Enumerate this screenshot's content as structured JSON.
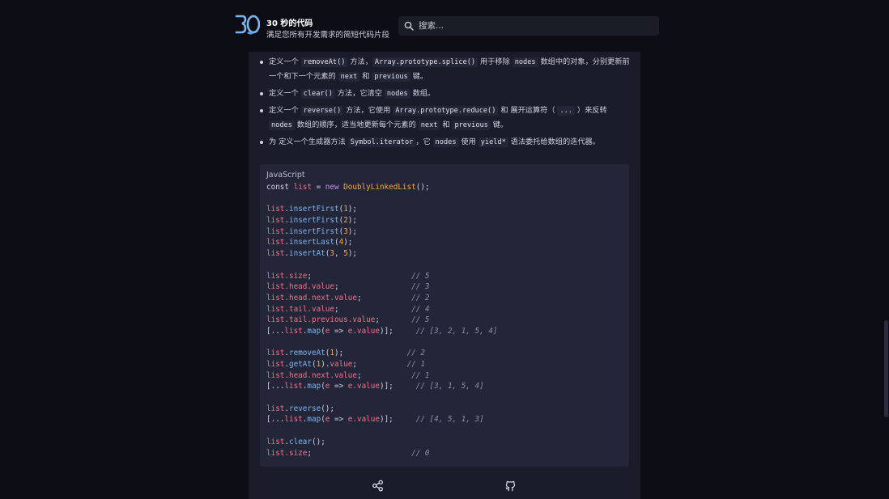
{
  "header": {
    "brand_title": "30 秒的代码",
    "brand_subtitle": "满足您所有开发需求的简短代码片段",
    "search_placeholder": "搜索..."
  },
  "bullets": [
    [
      {
        "t": "text",
        "v": "定义一个 "
      },
      {
        "t": "code",
        "v": "removeAt()"
      },
      {
        "t": "text",
        "v": " 方法，"
      },
      {
        "t": "code",
        "v": "Array.prototype.splice()"
      },
      {
        "t": "text",
        "v": " 用于移除 "
      },
      {
        "t": "code",
        "v": "nodes"
      },
      {
        "t": "text",
        "v": " 数组中的对象，分别更新前一个和下一个元素的 "
      },
      {
        "t": "code",
        "v": "next"
      },
      {
        "t": "text",
        "v": " 和 "
      },
      {
        "t": "code",
        "v": "previous"
      },
      {
        "t": "text",
        "v": " 键。"
      }
    ],
    [
      {
        "t": "text",
        "v": "定义一个 "
      },
      {
        "t": "code",
        "v": "clear()"
      },
      {
        "t": "text",
        "v": " 方法，它清空 "
      },
      {
        "t": "code",
        "v": "nodes"
      },
      {
        "t": "text",
        "v": " 数组。"
      }
    ],
    [
      {
        "t": "text",
        "v": "定义一个 "
      },
      {
        "t": "code",
        "v": "reverse()"
      },
      {
        "t": "text",
        "v": " 方法，它使用 "
      },
      {
        "t": "code",
        "v": "Array.prototype.reduce()"
      },
      {
        "t": "text",
        "v": " 和 展开运算符（ "
      },
      {
        "t": "code",
        "v": "..."
      },
      {
        "t": "text",
        "v": " ）来反转 "
      },
      {
        "t": "code",
        "v": "nodes"
      },
      {
        "t": "text",
        "v": " 数组的顺序，适当地更新每个元素的 "
      },
      {
        "t": "code",
        "v": "next"
      },
      {
        "t": "text",
        "v": " 和 "
      },
      {
        "t": "code",
        "v": "previous"
      },
      {
        "t": "text",
        "v": " 键。"
      }
    ],
    [
      {
        "t": "text",
        "v": "为 定义一个生成器方法 "
      },
      {
        "t": "code",
        "v": "Symbol.iterator"
      },
      {
        "t": "text",
        "v": "，它 "
      },
      {
        "t": "code",
        "v": "nodes"
      },
      {
        "t": "text",
        "v": " 使用 "
      },
      {
        "t": "code",
        "v": "yield*"
      },
      {
        "t": "text",
        "v": " 语法委托给数组的迭代器。"
      }
    ]
  ],
  "code_block": {
    "language": "JavaScript",
    "lines": [
      [
        [
          "kw",
          "const "
        ],
        [
          "var",
          "list"
        ],
        [
          "p",
          " = "
        ],
        [
          "new",
          "new "
        ],
        [
          "cls",
          "DoublyLinkedList"
        ],
        [
          "p",
          "();"
        ]
      ],
      [],
      [
        [
          "var",
          "list"
        ],
        [
          "p",
          "."
        ],
        [
          "fn",
          "insertFirst"
        ],
        [
          "p",
          "("
        ],
        [
          "num",
          "1"
        ],
        [
          "p",
          ");"
        ]
      ],
      [
        [
          "var",
          "list"
        ],
        [
          "p",
          "."
        ],
        [
          "fn",
          "insertFirst"
        ],
        [
          "p",
          "("
        ],
        [
          "num",
          "2"
        ],
        [
          "p",
          ");"
        ]
      ],
      [
        [
          "var",
          "list"
        ],
        [
          "p",
          "."
        ],
        [
          "fn",
          "insertFirst"
        ],
        [
          "p",
          "("
        ],
        [
          "num",
          "3"
        ],
        [
          "p",
          ");"
        ]
      ],
      [
        [
          "var",
          "list"
        ],
        [
          "p",
          "."
        ],
        [
          "fn",
          "insertLast"
        ],
        [
          "p",
          "("
        ],
        [
          "num",
          "4"
        ],
        [
          "p",
          ");"
        ]
      ],
      [
        [
          "var",
          "list"
        ],
        [
          "p",
          "."
        ],
        [
          "fn",
          "insertAt"
        ],
        [
          "p",
          "("
        ],
        [
          "num",
          "3"
        ],
        [
          "p",
          ", "
        ],
        [
          "num",
          "5"
        ],
        [
          "p",
          ");"
        ]
      ],
      [],
      [
        [
          "var",
          "list.size"
        ],
        [
          "p",
          ";                      "
        ],
        [
          "cmt",
          "// 5"
        ]
      ],
      [
        [
          "var",
          "list.head.value"
        ],
        [
          "p",
          ";                "
        ],
        [
          "cmt",
          "// 3"
        ]
      ],
      [
        [
          "var",
          "list.head.next.value"
        ],
        [
          "p",
          ";           "
        ],
        [
          "cmt",
          "// 2"
        ]
      ],
      [
        [
          "var",
          "list.tail.value"
        ],
        [
          "p",
          ";                "
        ],
        [
          "cmt",
          "// 4"
        ]
      ],
      [
        [
          "var",
          "list.tail.previous.value"
        ],
        [
          "p",
          ";       "
        ],
        [
          "cmt",
          "// 5"
        ]
      ],
      [
        [
          "p",
          "[..."
        ],
        [
          "var",
          "list"
        ],
        [
          "p",
          "."
        ],
        [
          "fn",
          "map"
        ],
        [
          "p",
          "("
        ],
        [
          "var",
          "e"
        ],
        [
          "p",
          " => "
        ],
        [
          "var",
          "e.value"
        ],
        [
          "p",
          ")];     "
        ],
        [
          "cmt",
          "// [3, 2, 1, 5, 4]"
        ]
      ],
      [],
      [
        [
          "var",
          "list"
        ],
        [
          "p",
          "."
        ],
        [
          "fn",
          "removeAt"
        ],
        [
          "p",
          "("
        ],
        [
          "num",
          "1"
        ],
        [
          "p",
          ");              "
        ],
        [
          "cmt",
          "// 2"
        ]
      ],
      [
        [
          "var",
          "list"
        ],
        [
          "p",
          "."
        ],
        [
          "fn",
          "getAt"
        ],
        [
          "p",
          "("
        ],
        [
          "num",
          "1"
        ],
        [
          "p",
          ")."
        ],
        [
          "var",
          "value"
        ],
        [
          "p",
          ";           "
        ],
        [
          "cmt",
          "// 1"
        ]
      ],
      [
        [
          "var",
          "list.head.next.value"
        ],
        [
          "p",
          ";           "
        ],
        [
          "cmt",
          "// 1"
        ]
      ],
      [
        [
          "p",
          "[..."
        ],
        [
          "var",
          "list"
        ],
        [
          "p",
          "."
        ],
        [
          "fn",
          "map"
        ],
        [
          "p",
          "("
        ],
        [
          "var",
          "e"
        ],
        [
          "p",
          " => "
        ],
        [
          "var",
          "e.value"
        ],
        [
          "p",
          ")];     "
        ],
        [
          "cmt",
          "// [3, 1, 5, 4]"
        ]
      ],
      [],
      [
        [
          "var",
          "list"
        ],
        [
          "p",
          "."
        ],
        [
          "fn",
          "reverse"
        ],
        [
          "p",
          "();"
        ]
      ],
      [
        [
          "p",
          "[..."
        ],
        [
          "var",
          "list"
        ],
        [
          "p",
          "."
        ],
        [
          "fn",
          "map"
        ],
        [
          "p",
          "("
        ],
        [
          "var",
          "e"
        ],
        [
          "p",
          " => "
        ],
        [
          "var",
          "e.value"
        ],
        [
          "p",
          ")];     "
        ],
        [
          "cmt",
          "// [4, 5, 1, 3]"
        ]
      ],
      [],
      [
        [
          "var",
          "list"
        ],
        [
          "p",
          "."
        ],
        [
          "fn",
          "clear"
        ],
        [
          "p",
          "();"
        ]
      ],
      [
        [
          "var",
          "list.size"
        ],
        [
          "p",
          ";                      "
        ],
        [
          "cmt",
          "// 0"
        ]
      ]
    ]
  },
  "icons": {
    "share": "share-icon",
    "github": "github-icon"
  },
  "colors": {
    "background": "#0d0e15",
    "card": "#1a1c2a",
    "code_background": "#232638",
    "logo_accent": "#7cb6f2",
    "variable": "#f0738a",
    "function": "#7cb6f2",
    "number": "#f6a84b",
    "keyword_new": "#c792ea"
  }
}
